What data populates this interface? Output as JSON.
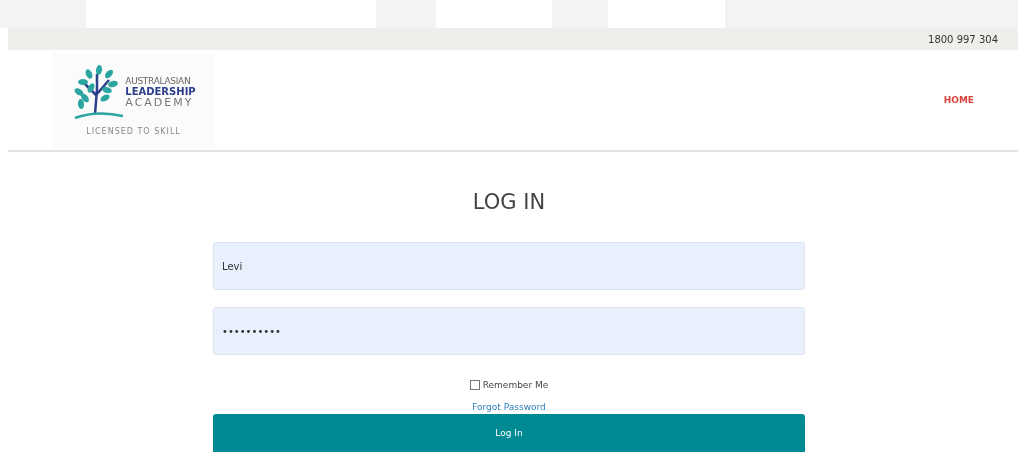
{
  "top_bar": {
    "phone": "1800 997 304"
  },
  "header": {
    "logo": {
      "line_1": "AUSTRALASIAN",
      "line_2": "LEADERSHIP",
      "line_3": "ACADEMY",
      "tagline": "LICENSED TO SKILL"
    },
    "nav": [
      {
        "label": "HOME",
        "selected": true
      }
    ]
  },
  "login": {
    "title": "LOG IN",
    "username": {
      "value": "Levi"
    },
    "password": {
      "value": "••••••••••"
    },
    "remember_me": {
      "label": "Remember Me",
      "checked": false
    },
    "forgot_link": "Forgot Password",
    "submit": "Log In"
  }
}
